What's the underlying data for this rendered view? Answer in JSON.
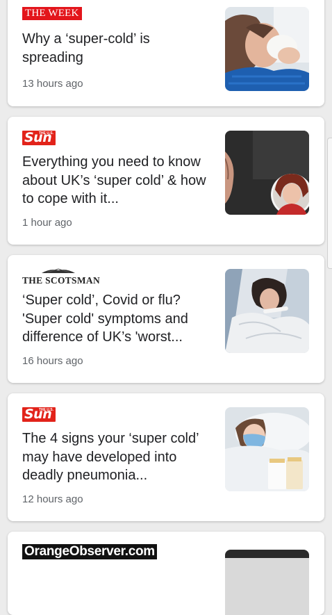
{
  "articles": [
    {
      "source": "THE WEEK",
      "title": "Why a ‘super-cold’ is spreading",
      "time": "13 hours ago"
    },
    {
      "source": "Sun",
      "source_small": "THE U.S.",
      "title": "Everything you need to know about UK’s ‘super cold’ & how to cope with it...",
      "time": "1 hour ago"
    },
    {
      "source": "THE SCOTSMAN",
      "title": "‘Super cold’, Covid or flu? 'Super cold' symptoms and difference of UK’s 'worst...",
      "time": "16 hours ago"
    },
    {
      "source": "Sun",
      "source_small": "THE U.S.",
      "title": "The 4 signs your ‘super cold’ may have developed into deadly pneumonia...",
      "time": "12 hours ago"
    },
    {
      "source": "OrangeObserver.com"
    }
  ],
  "colors": {
    "background": "#ececec",
    "card": "#ffffff",
    "week_red": "#e3151b",
    "sun_red": "#e2231a",
    "title_text": "#202124",
    "meta_text": "#5f6368"
  }
}
